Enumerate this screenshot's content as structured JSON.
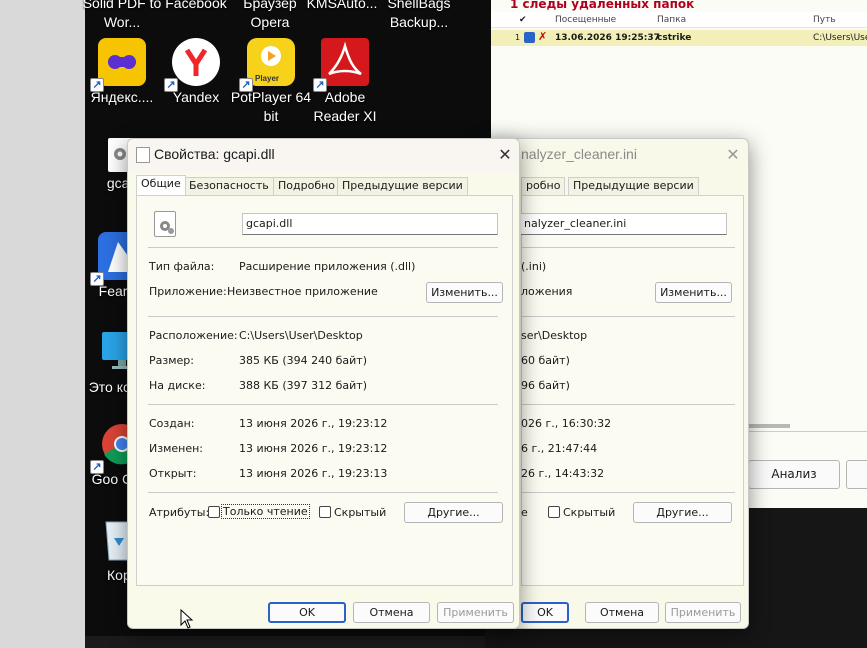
{
  "desktop": {
    "icons": [
      {
        "name": "solid-pdf",
        "label": "Solid PDF to Wor..."
      },
      {
        "name": "facebook",
        "label": "Facebook"
      },
      {
        "name": "opera",
        "label": "Браузер Opera"
      },
      {
        "name": "kmsauto",
        "label": "KMSAuto..."
      },
      {
        "name": "shellbags",
        "label": "ShellBags Backup..."
      },
      {
        "name": "yandex-games",
        "label": "Яндекс...."
      },
      {
        "name": "yandex",
        "label": "Yandex"
      },
      {
        "name": "potplayer",
        "label": "PotPlayer 64 bit"
      },
      {
        "name": "adobe-reader",
        "label": "Adobe Reader XI"
      },
      {
        "name": "gcapi",
        "label": "gcap"
      },
      {
        "name": "fearch",
        "label": "FearCh"
      },
      {
        "name": "this-pc",
        "label": "Это компь"
      },
      {
        "name": "google-chrome",
        "label": "Goo Chro"
      },
      {
        "name": "recycle-bin",
        "label": "Корз"
      }
    ],
    "potplayer_badge": "Player"
  },
  "app": {
    "heading": "1  следы удаленных папок",
    "columns": {
      "check": "✔",
      "visited": "Посещенные",
      "folder": "Папка",
      "path": "Путь"
    },
    "rows": [
      {
        "num": "1",
        "visited": "13.06.2026 19:25:37",
        "folder": "cstrike",
        "path": "C:\\Users\\User"
      }
    ],
    "analyze_button": "Анализ"
  },
  "dialog_main": {
    "title": "Свойства: gcapi.dll",
    "tabs": [
      "Общие",
      "Безопасность",
      "Подробно",
      "Предыдущие версии"
    ],
    "filename": "gcapi.dll",
    "file_type_label": "Тип файла:",
    "file_type": "Расширение приложения (.dll)",
    "app_label": "Приложение:",
    "app_value": "Неизвестное приложение",
    "change_button": "Изменить...",
    "location_label": "Расположение:",
    "location": "C:\\Users\\User\\Desktop",
    "size_label": "Размер:",
    "size": "385 КБ (394 240 байт)",
    "disk_label": "На диске:",
    "disk": "388 КБ (397 312 байт)",
    "created_label": "Создан:",
    "created": "13 июня 2026 г., 19:23:12",
    "modified_label": "Изменен:",
    "modified": "13 июня 2026 г., 19:23:12",
    "opened_label": "Открыт:",
    "opened": "13 июня 2026 г., 19:23:13",
    "attributes_label": "Атрибуты:",
    "readonly_label": "Только чтение",
    "hidden_label": "Скрытый",
    "other_button": "Другие...",
    "ok": "OK",
    "cancel": "Отмена",
    "apply": "Применить"
  },
  "dialog_back": {
    "title": "nalyzer_cleaner.ini",
    "tabs": [
      "робно",
      "Предыдущие версии"
    ],
    "filename": "nalyzer_cleaner.ini",
    "file_type": "(.ini)",
    "app_value": "ложения",
    "change_button": "Изменить...",
    "location": "ser\\Desktop",
    "size": "60 байт)",
    "disk": "96 байт)",
    "created": "026 г., 16:30:32",
    "modified": "6 г., 21:47:44",
    "opened": "26 г., 14:43:32",
    "attributes_tail": "е",
    "hidden_label": "Скрытый",
    "other_button": "Другие...",
    "ok": "OK",
    "cancel": "Отмена",
    "apply": "Применить"
  }
}
